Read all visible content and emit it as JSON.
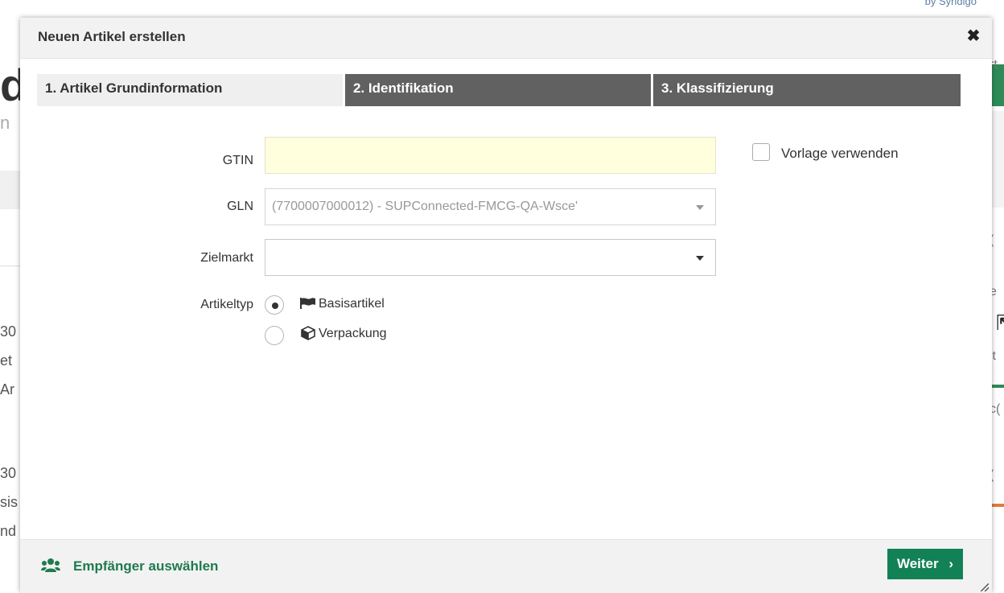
{
  "background": {
    "brand_text": "by Syndigo",
    "left_letter": "d",
    "left_fragments": [
      "30",
      "et",
      "Ar",
      "30",
      "sis",
      "nd"
    ],
    "right_fragments": [
      "rt",
      "(",
      "e",
      "it",
      "c(",
      "("
    ]
  },
  "modal": {
    "title": "Neuen Artikel erstellen",
    "close_symbol": "✖",
    "tabs": [
      {
        "label": "1. Artikel Grundinformation",
        "active": true
      },
      {
        "label": "2. Identifikation",
        "active": false
      },
      {
        "label": "3. Klassifizierung",
        "active": false
      }
    ],
    "form": {
      "gtin_label": "GTIN",
      "gtin_value": "",
      "template_checkbox_label": "Vorlage verwenden",
      "template_checked": false,
      "gln_label": "GLN",
      "gln_value": "(7700007000012) - SUPConnected-FMCG-QA-Wsce'",
      "target_market_label": "Zielmarkt",
      "target_market_value": "",
      "article_type_label": "Artikeltyp",
      "article_type_options": [
        {
          "label": "Basisartikel",
          "selected": true,
          "icon": "flag-icon"
        },
        {
          "label": "Verpackung",
          "selected": false,
          "icon": "box-icon"
        }
      ]
    },
    "footer": {
      "recipients_label": "Empfänger auswählen",
      "next_label": "Weiter",
      "next_arrow": "›"
    }
  },
  "colors": {
    "tab_inactive": "#616161",
    "primary_green": "#138156",
    "link_green": "#1f7a4d",
    "gtin_highlight": "#ffffdd"
  }
}
